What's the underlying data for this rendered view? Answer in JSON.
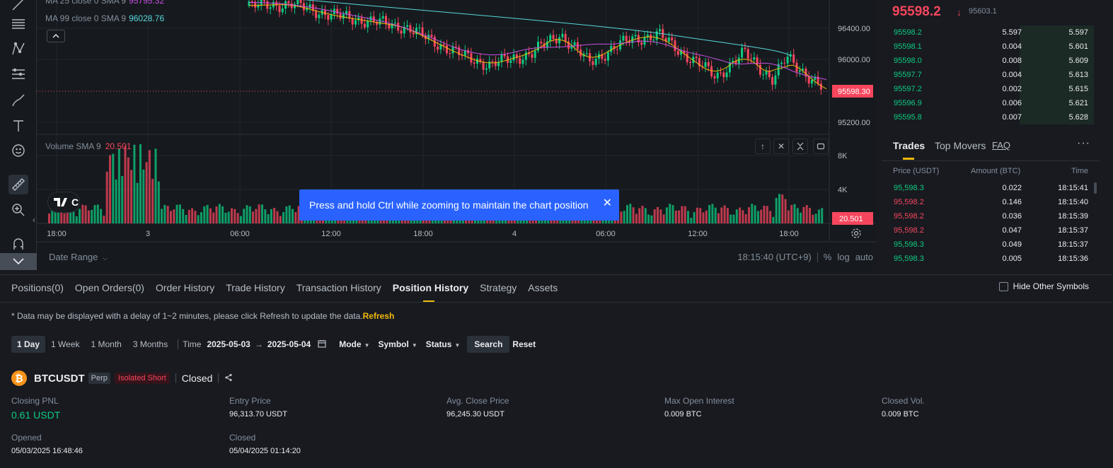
{
  "chart": {
    "ma_lines": [
      {
        "label": "MA 25 close 0 SMA 9",
        "value": "95795.32",
        "color": "#c64fe0"
      },
      {
        "label": "MA 99 close 0 SMA 9",
        "value": "96028.76",
        "color": "#58d7dd"
      }
    ],
    "ma_collapse_icon": "chevron-up-icon",
    "price_axis": [
      "96400.00",
      "96000.00",
      "95200.00"
    ],
    "current_price_tag": "95598.30",
    "volume_label": "Volume SMA 9",
    "volume_value": "20.501",
    "volume_axis": [
      "8K",
      "4K"
    ],
    "volume_tag": "20.501",
    "time_axis": [
      "18:00",
      "3",
      "06:00",
      "12:00",
      "18:00",
      "4",
      "06:00",
      "12:00",
      "18:00"
    ],
    "tv_logo_text": "C",
    "toast_message": "Press and hold Ctrl while zooming to maintain the chart position",
    "date_range_label": "Date Range",
    "clock": "18:15:40 (UTC+9)",
    "scale_options": [
      "%",
      "log",
      "auto"
    ],
    "colors": {
      "up": "#0ecb81",
      "down": "#f6465d",
      "ma7": "#f0b90b",
      "ma25": "#c64fe0",
      "ma99": "#58d7dd"
    }
  },
  "orderbook": {
    "last_price": "95598.2",
    "arrow": "↓",
    "mark_price": "95603.1",
    "bids": [
      {
        "price": "95598.2",
        "amount": "5.597",
        "total": "5.597",
        "depth": 0.35
      },
      {
        "price": "95598.1",
        "amount": "0.004",
        "total": "5.601",
        "depth": 0.35
      },
      {
        "price": "95598.0",
        "amount": "0.008",
        "total": "5.609",
        "depth": 0.35
      },
      {
        "price": "95597.7",
        "amount": "0.004",
        "total": "5.613",
        "depth": 0.35
      },
      {
        "price": "95597.2",
        "amount": "0.002",
        "total": "5.615",
        "depth": 0.35
      },
      {
        "price": "95596.9",
        "amount": "0.006",
        "total": "5.621",
        "depth": 0.35
      },
      {
        "price": "95595.8",
        "amount": "0.007",
        "total": "5.628",
        "depth": 0.35
      }
    ]
  },
  "trades": {
    "tabs": [
      "Trades",
      "Top Movers",
      "FAQ"
    ],
    "more_icon": "more-dots-icon",
    "headers": [
      "Price (USDT)",
      "Amount (BTC)",
      "Time"
    ],
    "rows": [
      {
        "price": "95,598.3",
        "amount": "0.022",
        "time": "18:15:41",
        "side": "buy"
      },
      {
        "price": "95,598.2",
        "amount": "0.146",
        "time": "18:15:40",
        "side": "sell"
      },
      {
        "price": "95,598.2",
        "amount": "0.036",
        "time": "18:15:39",
        "side": "sell"
      },
      {
        "price": "95,598.2",
        "amount": "0.047",
        "time": "18:15:37",
        "side": "sell"
      },
      {
        "price": "95,598.3",
        "amount": "0.049",
        "time": "18:15:37",
        "side": "buy"
      },
      {
        "price": "95,598.3",
        "amount": "0.005",
        "time": "18:15:36",
        "side": "buy"
      }
    ]
  },
  "bottom": {
    "tabs": [
      "Positions(0)",
      "Open Orders(0)",
      "Order History",
      "Trade History",
      "Transaction History",
      "Position History",
      "Strategy",
      "Assets"
    ],
    "active_tab": "Position History",
    "hide_other_symbols": "Hide Other Symbols",
    "notice": "* Data may be displayed with a delay of 1~2 minutes, please click Refresh to update the data.",
    "refresh": "Refresh",
    "filters": {
      "periods": [
        "1 Day",
        "1 Week",
        "1 Month",
        "3 Months"
      ],
      "selected_period": "1 Day",
      "time_label": "Time",
      "date_from": "2025-05-03",
      "date_to": "2025-05-04",
      "mode": "Mode",
      "symbol": "Symbol",
      "status": "Status",
      "search": "Search",
      "reset": "Reset"
    },
    "position": {
      "coin_glyph": "₿",
      "symbol": "BTCUSDT",
      "type": "Perp",
      "margin": "Isolated Short",
      "status": "Closed",
      "fields": [
        {
          "label": "Closing PNL",
          "value": "0.61 USDT"
        },
        {
          "label": "Entry Price",
          "value": "96,313.70 USDT"
        },
        {
          "label": "Avg. Close Price",
          "value": "96,245.30 USDT"
        },
        {
          "label": "Max Open Interest",
          "value": "0.009 BTC"
        },
        {
          "label": "Closed Vol.",
          "value": "0.009 BTC"
        },
        {
          "label": "Opened",
          "value": "05/03/2025 16:48:46"
        },
        {
          "label": "Closed",
          "value": "05/04/2025 01:14:20"
        }
      ]
    }
  }
}
